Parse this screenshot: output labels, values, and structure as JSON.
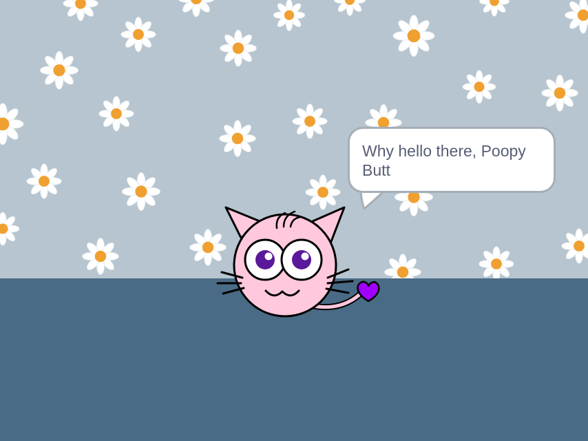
{
  "stage": {
    "backdrop": "daisy-wallpaper",
    "colors": {
      "wall": "#b6c5cf",
      "floor": "#4a6b86",
      "daisy_petal": "#ffffff",
      "daisy_center": "#f0a030"
    }
  },
  "speech_bubble": {
    "text": "Why hello there, Poopy Butt"
  },
  "sprite": {
    "icon": "cat-sprite",
    "colors": {
      "body": "#ffc8dc",
      "eye_iris": "#5a189a",
      "tail_heart": "#a100ff"
    }
  }
}
